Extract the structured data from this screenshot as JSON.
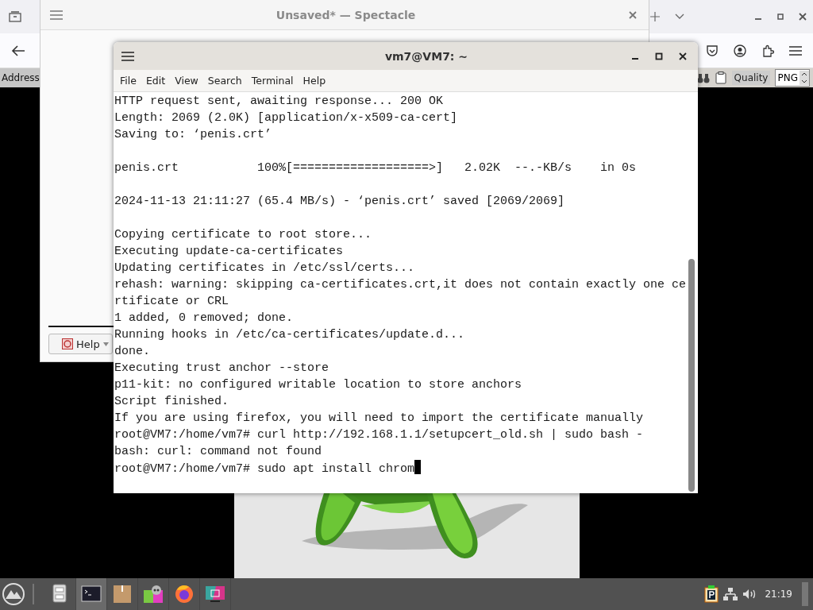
{
  "browser": {
    "address_label": "Address",
    "quality_label": "Quality",
    "format_value": "PNG"
  },
  "spectacle": {
    "title": "Unsaved* — Spectacle",
    "help_button": "Help"
  },
  "terminal": {
    "title": "vm7@VM7: ~",
    "menu": [
      "File",
      "Edit",
      "View",
      "Search",
      "Terminal",
      "Help"
    ],
    "blocks": [
      [
        "HTTP request sent, awaiting response... 200 OK",
        "Length: 2069 (2.0K) [application/x-x509-ca-cert]",
        "Saving to: ‘penis.crt’"
      ],
      [
        "penis.crt           100%[===================>]   2.02K  --.-KB/s    in 0s"
      ],
      [
        "2024-11-13 21:11:27 (65.4 MB/s) - ‘penis.crt’ saved [2069/2069]"
      ],
      [
        "Copying certificate to root store...",
        "Executing update-ca-certificates",
        "Updating certificates in /etc/ssl/certs...",
        "rehash: warning: skipping ca-certificates.crt,it does not contain exactly one ce",
        "rtificate or CRL",
        "1 added, 0 removed; done.",
        "Running hooks in /etc/ca-certificates/update.d...",
        "done.",
        "Executing trust anchor --store",
        "p11-kit: no configured writable location to store anchors",
        "Script finished.",
        "If you are using firefox, you will need to import the certificate manually",
        "root@VM7:/home/vm7# curl http://192.168.1.1/setupcert_old.sh | sudo bash -",
        "bash: curl: command not found",
        "root@VM7:/home/vm7# sudo apt install chrom"
      ]
    ]
  },
  "taskbar": {
    "apps": [
      {
        "kind": "files",
        "selected": false
      },
      {
        "kind": "terminal",
        "selected": true
      },
      {
        "kind": "archive",
        "selected": false
      },
      {
        "kind": "gimp",
        "selected": false
      },
      {
        "kind": "firefox",
        "selected": false
      },
      {
        "kind": "screenshot",
        "selected": false
      }
    ],
    "clock": "21:19"
  }
}
